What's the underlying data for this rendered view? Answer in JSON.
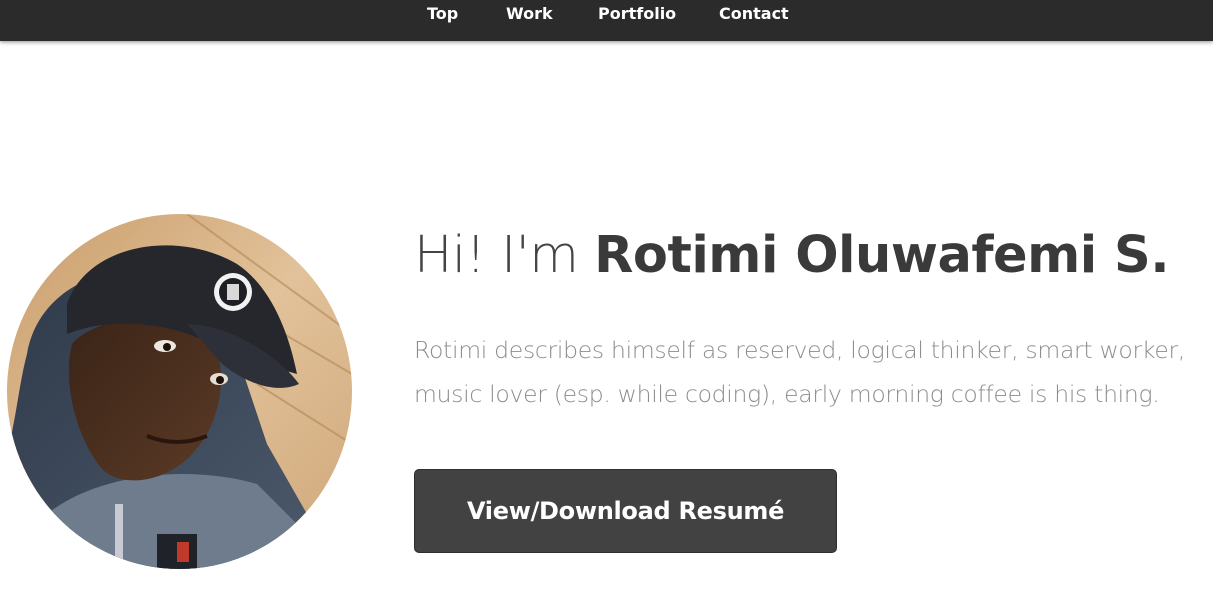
{
  "nav": {
    "items": [
      {
        "label": "Top"
      },
      {
        "label": "Work"
      },
      {
        "label": "Portfolio"
      },
      {
        "label": "Contact"
      }
    ]
  },
  "hero": {
    "greeting": "Hi! I'm ",
    "name": "Rotimi Oluwafemi S.",
    "bio": "Rotimi describes himself as reserved, logical thinker, smart worker, music lover (esp. while coding), early morning coffee is his thing.",
    "resume_button": "View/Download Resumé"
  },
  "colors": {
    "topbar": "#2b2b2b",
    "button": "#424242",
    "heading": "#3a3a3a",
    "bio_text": "#8c8c8c"
  }
}
